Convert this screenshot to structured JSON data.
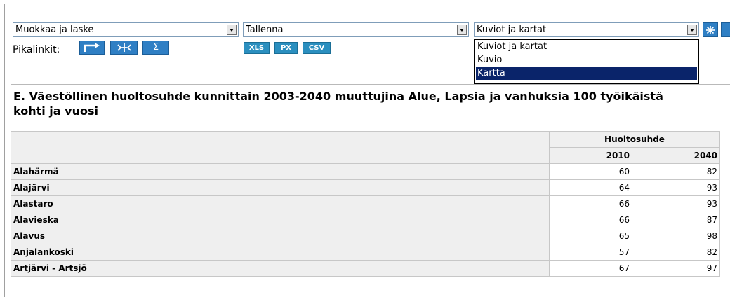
{
  "toolbar": {
    "edit_select": "Muokkaa ja laske",
    "save_select": "Tallenna",
    "chart_select": "Kuviot ja kartat",
    "pikalinkit_label": "Pikalinkit:",
    "quick_sigma": "Σ",
    "xls": "XLS",
    "px": "PX",
    "csv": "CSV"
  },
  "dropdown": {
    "options": [
      "Kuviot ja kartat",
      "Kuvio",
      "Kartta"
    ],
    "selected": "Kartta"
  },
  "table": {
    "title": "E. Väestöllinen huoltosuhde kunnittain 2003-2040 muuttujina Alue, Lapsia ja vanhuksia 100 työikäistä kohti ja vuosi",
    "group_header": "Huoltosuhde",
    "years": [
      "2010",
      "2040"
    ],
    "rows": [
      {
        "name": "Alahärmä",
        "v2010": "60",
        "v2040": "82"
      },
      {
        "name": "Alajärvi",
        "v2010": "64",
        "v2040": "93"
      },
      {
        "name": "Alastaro",
        "v2010": "66",
        "v2040": "93"
      },
      {
        "name": "Alavieska",
        "v2010": "66",
        "v2040": "87"
      },
      {
        "name": "Alavus",
        "v2010": "65",
        "v2040": "98"
      },
      {
        "name": "Anjalankoski",
        "v2010": "57",
        "v2040": "82"
      },
      {
        "name": "Artjärvi - Artsjö",
        "v2010": "67",
        "v2040": "97"
      }
    ]
  },
  "colors": {
    "button_blue": "#2f7fc4",
    "selection": "#0a246a"
  }
}
